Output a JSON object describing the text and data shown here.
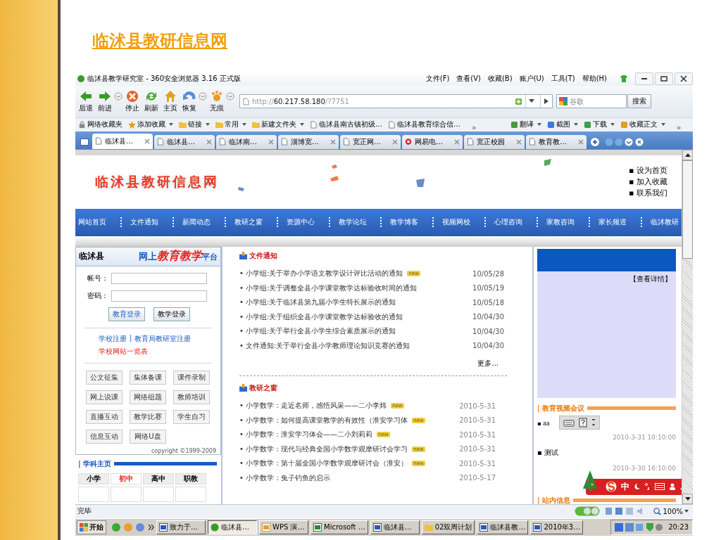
{
  "slide_title": "临沭县教研信息网",
  "browser": {
    "title": "临沭县教学研究室 - 360安全浏览器 3.16 正式版",
    "menu": [
      "文件(F)",
      "查看(V)",
      "收藏(B)",
      "账户(U)",
      "工具(T)",
      "帮助(H)"
    ],
    "nav_buttons": [
      {
        "kind": "back",
        "label": "后退",
        "dropdown": false
      },
      {
        "kind": "forward",
        "label": "前进",
        "dropdown": true
      },
      {
        "kind": "stop",
        "label": "停止",
        "dropdown": false
      },
      {
        "kind": "refresh",
        "label": "刷新",
        "dropdown": false
      },
      {
        "kind": "home",
        "label": "主页",
        "dropdown": false
      },
      {
        "kind": "restore",
        "label": "恢复",
        "dropdown": true
      },
      {
        "kind": "private",
        "label": "无痕",
        "dropdown": true
      }
    ],
    "address": {
      "scheme": "http://",
      "host": "60.217.58.180",
      "path": "/?7751"
    },
    "search": {
      "placeholder": "谷歌",
      "button": "搜索"
    },
    "bookmarks": [
      {
        "kind": "lock",
        "label": "网络收藏夹",
        "dropdown": false
      },
      {
        "kind": "star",
        "label": "添加收藏",
        "dropdown": true
      },
      {
        "kind": "folder",
        "label": "链接",
        "dropdown": true
      },
      {
        "kind": "folder",
        "label": "常用",
        "dropdown": true
      },
      {
        "kind": "folder",
        "label": "新建文件夹",
        "dropdown": true
      },
      {
        "kind": "page",
        "label": "临沭县南古镇初级…",
        "dropdown": false
      },
      {
        "kind": "page",
        "label": "临沭县教育综合信…",
        "dropdown": false
      },
      {
        "kind": "more",
        "label": "»"
      },
      {
        "kind": "translate",
        "label": "翻译",
        "dropdown": true
      },
      {
        "kind": "capture",
        "label": "截图",
        "dropdown": true
      },
      {
        "kind": "download",
        "label": "下载",
        "dropdown": true
      },
      {
        "kind": "clip",
        "label": "收藏正文",
        "dropdown": true
      },
      {
        "kind": "more",
        "label": "»"
      }
    ],
    "tabs": [
      {
        "label": "临沭县…",
        "selected": true,
        "kind": "page"
      },
      {
        "label": "临沭县…",
        "selected": false,
        "kind": "page"
      },
      {
        "label": "临沭南…",
        "selected": false,
        "kind": "page"
      },
      {
        "label": "淄博宽…",
        "selected": false,
        "kind": "page"
      },
      {
        "label": "宽正网…",
        "selected": false,
        "kind": "page"
      },
      {
        "label": "网易电…",
        "selected": false,
        "kind": "netease"
      },
      {
        "label": "宽正校园",
        "selected": false,
        "kind": "page"
      },
      {
        "label": "教育教…",
        "selected": false,
        "kind": "page"
      }
    ],
    "status": "完毕",
    "zoom": "100%"
  },
  "page": {
    "logo": "临沭县教研信息网",
    "header_links": [
      "▪ 设为首页",
      "▪ 加入收藏",
      "▪ 联系我们"
    ],
    "nav": [
      "网站首页",
      "文件通知",
      "新闻动态",
      "教研之窗",
      "资源中心",
      "教学论坛",
      "教学博客",
      "视频网校",
      "心理咨询",
      "家教咨询",
      "家长频道",
      "临沭教研"
    ],
    "login": {
      "county": "临沭县",
      "platform_prefix": "网上",
      "platform_main": "教育教学",
      "platform_suffix": "平台",
      "account_label": "帐号：",
      "password_label": "密码：",
      "buttons": [
        "教育登录",
        "教学登录"
      ],
      "links": [
        "学校注册",
        "教育局教研室注册"
      ],
      "link_separator": "|",
      "school_list": "学校网站一览表"
    },
    "tools": [
      "公文征集",
      "集体备课",
      "课件录制",
      "网上说课",
      "网络组题",
      "教师培训",
      "直播互动",
      "教学比赛",
      "学生自习",
      "信息互动",
      "网络U盘"
    ],
    "copyright": "copyright ©1999-2009",
    "subjects": {
      "title": "| 学科主页",
      "tabs": [
        {
          "label": "小学",
          "selected": false
        },
        {
          "label": "初中",
          "selected": true
        },
        {
          "label": "高中",
          "selected": false
        },
        {
          "label": "职教",
          "selected": false
        }
      ]
    },
    "notices": {
      "title": "文件通知",
      "more": "更多...",
      "items": [
        {
          "text": "• 小学组:关于举办小学语文教学设计评比活动的通知",
          "badge": "new",
          "date": "10/05/28"
        },
        {
          "text": "• 小学组:关于调整全县小学课堂教学达标验收时间的通知",
          "date": "10/05/19"
        },
        {
          "text": "• 小学组:关于临沭县第九届小学生特长展示的通知",
          "date": "10/05/18"
        },
        {
          "text": "• 小学组:关于组织全县小学课堂教学达标验收的通知",
          "date": "10/04/30"
        },
        {
          "text": "• 小学组:关于举行全县小学生综合素质展示的通知",
          "date": "10/04/30"
        },
        {
          "text": "• 文件通知:关于举行全县小学教师理论知识竞赛的通知",
          "date": "10/04/30"
        }
      ]
    },
    "research": {
      "title": "教研之窗",
      "items": [
        {
          "text": "• 小学数学：走近名师，感悟风采——二小李炜",
          "badge": "new",
          "date": "2010-5-31"
        },
        {
          "text": "• 小学数学：如何提高课堂教学的有效性（淮安学习体",
          "badge": "new",
          "date": "2010-5-31"
        },
        {
          "text": "• 小学数学：淮安学习体会——二小刘莉莉",
          "badge": "new",
          "date": "2010-5-31"
        },
        {
          "text": "• 小学数学：现代与经典全国小学数学观摩研讨会学习",
          "badge": "new",
          "date": "2010-5-31"
        },
        {
          "text": "• 小学数学：第十届全国小学数学观摩研讨会（淮安）",
          "badge": "new",
          "date": "2010-5-31"
        },
        {
          "text": "• 小学数学：兔子钓鱼的启示",
          "date": "2010-5-17"
        }
      ]
    },
    "details": "【查看详情】",
    "video": {
      "title": "| 教育视频会议",
      "entries": [
        {
          "text": "▪ aa",
          "time": "2010-3-31 10:10:00"
        },
        {
          "text": "▪ 测试",
          "time": "2010-3-30 16:10:00"
        }
      ]
    },
    "site_info": "| 站内信息",
    "ime": "中"
  },
  "taskbar": {
    "start": "开始",
    "items": [
      {
        "kind": "doc",
        "label": "致力于…",
        "selected": false
      },
      {
        "kind": "browser",
        "label": "临沭县…",
        "selected": true
      },
      {
        "kind": "wps",
        "label": "WPS 演…",
        "selected": false
      },
      {
        "kind": "excel",
        "label": "Microsoft …",
        "selected": false
      },
      {
        "kind": "doc",
        "label": "临沭县…",
        "selected": false
      },
      {
        "kind": "folder",
        "label": "02双周计划",
        "selected": false
      },
      {
        "kind": "doc",
        "label": "临沭县教…",
        "selected": false
      },
      {
        "kind": "doc",
        "label": "2010年3…",
        "selected": false
      }
    ],
    "clock": "20:23"
  }
}
